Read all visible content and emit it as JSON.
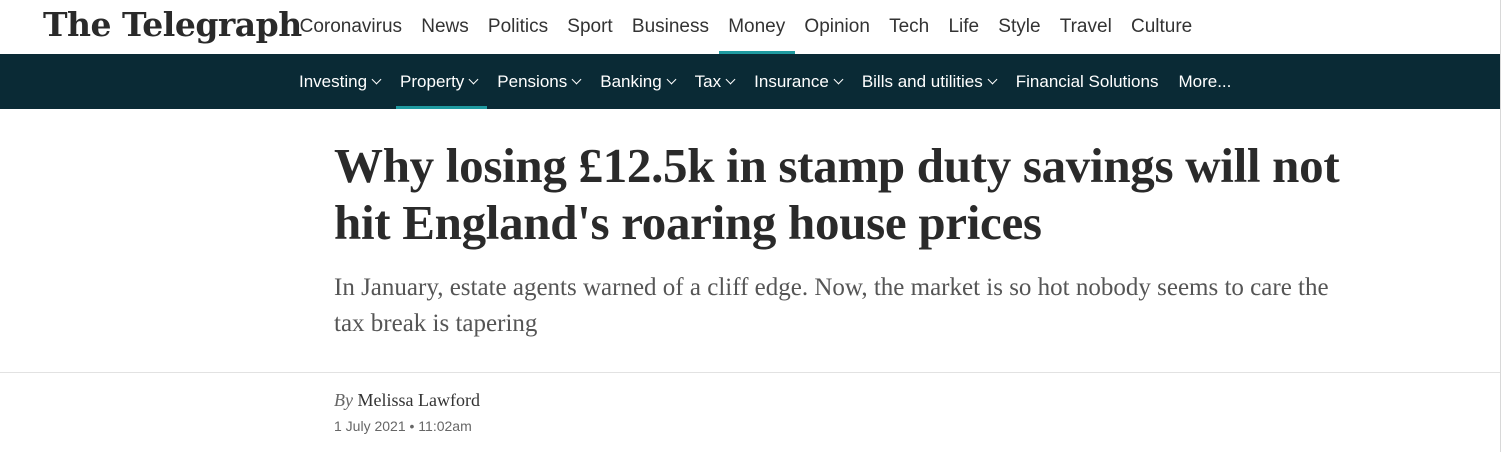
{
  "header": {
    "logo_text": "The Telegraph",
    "nav": [
      {
        "label": "Coronavirus",
        "active": false
      },
      {
        "label": "News",
        "active": false
      },
      {
        "label": "Politics",
        "active": false
      },
      {
        "label": "Sport",
        "active": false
      },
      {
        "label": "Business",
        "active": false
      },
      {
        "label": "Money",
        "active": true
      },
      {
        "label": "Opinion",
        "active": false
      },
      {
        "label": "Tech",
        "active": false
      },
      {
        "label": "Life",
        "active": false
      },
      {
        "label": "Style",
        "active": false
      },
      {
        "label": "Travel",
        "active": false
      },
      {
        "label": "Culture",
        "active": false
      }
    ]
  },
  "subnav": {
    "items": [
      {
        "label": "Investing",
        "dropdown": true,
        "active": false
      },
      {
        "label": "Property",
        "dropdown": true,
        "active": true
      },
      {
        "label": "Pensions",
        "dropdown": true,
        "active": false
      },
      {
        "label": "Banking",
        "dropdown": true,
        "active": false
      },
      {
        "label": "Tax",
        "dropdown": true,
        "active": false
      },
      {
        "label": "Insurance",
        "dropdown": true,
        "active": false
      },
      {
        "label": "Bills and utilities",
        "dropdown": true,
        "active": false
      },
      {
        "label": "Financial Solutions",
        "dropdown": false,
        "active": false
      },
      {
        "label": "More...",
        "dropdown": false,
        "active": false
      }
    ]
  },
  "article": {
    "headline": "Why losing £12.5k in stamp duty savings will not hit England's roaring house prices",
    "standfirst": "In January, estate agents warned of a cliff edge. Now, the market is so hot nobody seems to care the tax break is tapering",
    "byline_prefix": "By",
    "author": "Melissa Lawford",
    "date": "1 July 2021",
    "separator": "•",
    "time": "11:02am"
  },
  "colors": {
    "subnav_bg": "#0a2a35",
    "accent": "#1f9aa0",
    "text": "#333333"
  }
}
